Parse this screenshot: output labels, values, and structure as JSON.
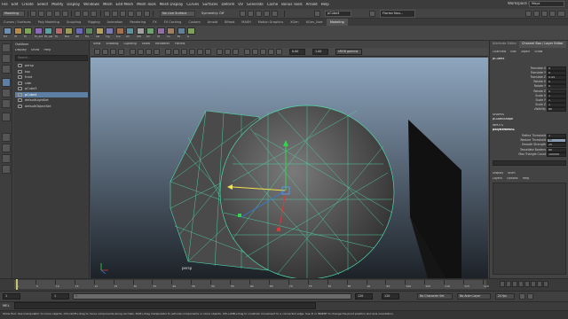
{
  "menubar": {
    "items": [
      "File",
      "Edit",
      "Create",
      "Select",
      "Modify",
      "Display",
      "Windows",
      "Mesh",
      "Edit Mesh",
      "Mesh Tools",
      "Mesh Display",
      "Curves",
      "Surfaces",
      "Deform",
      "UV",
      "Generate",
      "Cache",
      "Bonus Tools",
      "Arnold",
      "Help"
    ],
    "workspace_label": "Workspace :",
    "workspace_value": "Maya"
  },
  "statusline": {
    "mode": "Modeling",
    "no_live_surface": "No Live Surface",
    "symmetry": "Symmetry: Off",
    "object_field": "pCube4",
    "user": "Florian Nou..."
  },
  "shelf_tabs": [
    "Curves / Surfaces",
    "Poly Modeling",
    "Sculpting",
    "Rigging",
    "Animation",
    "Rendering",
    "FX",
    "FX Caching",
    "Custom",
    "Arnold",
    "Bifrost",
    "MASH",
    "Motion Graphics",
    "XGen",
    "XGen_User",
    "Modeling"
  ],
  "shelf_tabs_active_index": 15,
  "shelf_icons": [
    "Tut",
    "DF",
    "Tri",
    "PS_Ast",
    "PS_ast",
    "PS",
    "Box",
    "MO",
    "Tre",
    "Gat",
    "Cig",
    "Sce",
    "LD",
    "CPS",
    "LD",
    "CP",
    "Co",
    "BS",
    "G"
  ],
  "outliner": {
    "title": "Outliner",
    "menu": [
      "Display",
      "Show",
      "Help"
    ],
    "search_placeholder": "Search...",
    "items": [
      {
        "label": "persp",
        "selected": false
      },
      {
        "label": "top",
        "selected": false
      },
      {
        "label": "front",
        "selected": false
      },
      {
        "label": "side",
        "selected": false
      },
      {
        "label": "pCube3",
        "selected": false
      },
      {
        "label": "pCube4",
        "selected": true
      },
      {
        "label": "defaultLightSet",
        "selected": false
      },
      {
        "label": "defaultObjectSet",
        "selected": false
      }
    ]
  },
  "viewport": {
    "menu": [
      "View",
      "Shading",
      "Lighting",
      "Show",
      "Renderer",
      "Panels"
    ],
    "field_a": "0.00",
    "field_b": "1.00",
    "color_space": "sRGB gamma",
    "camera_label": "persp"
  },
  "attribute_editor": {
    "tabs": [
      "Attribute Editor",
      "Channel Box / Layer Editor"
    ],
    "active_tab_index": 1,
    "menu": [
      "Channels",
      "Edit",
      "Object",
      "Show"
    ],
    "object_name": "pCube4",
    "channels": [
      {
        "name": "Translate X",
        "value": "0"
      },
      {
        "name": "Translate Y",
        "value": "0"
      },
      {
        "name": "Translate Z",
        "value": "0.45"
      },
      {
        "name": "Rotate X",
        "value": "0"
      },
      {
        "name": "Rotate Y",
        "value": "0"
      },
      {
        "name": "Rotate Z",
        "value": "0"
      },
      {
        "name": "Scale X",
        "value": "1"
      },
      {
        "name": "Scale Y",
        "value": "1"
      },
      {
        "name": "Scale Z",
        "value": "1"
      },
      {
        "name": "Visibility",
        "value": "on"
      }
    ],
    "shapes_title": "SHAPES",
    "shape_name": "pCube4Shape",
    "inputs_title": "INPUTS",
    "input_name": "polyRemesh1",
    "inputs": [
      {
        "name": "Refine Threshold",
        "value": "1",
        "highlight": false
      },
      {
        "name": "Reduce Threshold",
        "value": "50",
        "highlight": true
      },
      {
        "name": "Smooth Strength",
        "value": "20",
        "highlight": false
      },
      {
        "name": "Tessellate Borders",
        "value": "on",
        "highlight": false
      },
      {
        "name": "Max Triangle Count",
        "value": "100000",
        "highlight": false
      }
    ],
    "lower_tabs": [
      "Display",
      "Anim"
    ],
    "lower_menu": [
      "Layers",
      "Options",
      "Help"
    ]
  },
  "timeline": {
    "ticks": [
      "1",
      "5",
      "10",
      "15",
      "20",
      "25",
      "30",
      "35",
      "40",
      "45",
      "50",
      "55",
      "60",
      "65",
      "70",
      "75",
      "80",
      "85",
      "90",
      "95",
      "100",
      "105",
      "110",
      "115",
      "120"
    ],
    "current_frame": "1"
  },
  "range": {
    "start": "1",
    "start_inner": "1",
    "bar_label": "1",
    "end_inner": "120",
    "end": "120",
    "end_max": "200",
    "character_set": "No Character Set",
    "anim_layer": "No Anim Layer",
    "fps": "24 fps"
  },
  "cmdline": {
    "label": "MEL"
  },
  "helpline": {
    "text": "Show Tool: Use manipulator to move objects. Ctrl+Shift+drag to move components along normals. Shift+drag manipulator to extrude components or clone objects. Ctrl+LMB+drag to constrain movement to a connected edge. Use D or INSERT to change the pivot position and axis orientation."
  }
}
